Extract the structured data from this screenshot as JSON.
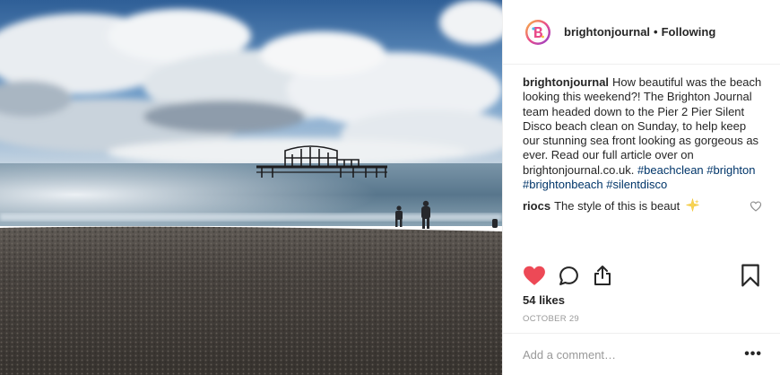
{
  "post": {
    "author": "brightonjournal",
    "follow_status": "Following",
    "separator": "•",
    "caption": "How beautiful was the beach looking this weekend?! The Brighton Journal team headed down to the Pier 2 Pier Silent Disco beach clean on Sunday, to help keep our stunning sea front looking as gorgeous as ever. Read our full article over on brightonjournal.co.uk.",
    "hashtags": [
      "#beachclean",
      "#brighton",
      "#brightonbeach",
      "#silentdisco"
    ],
    "comment": {
      "user": "riocs",
      "text": "The style of this is beaut"
    },
    "likes": "54 likes",
    "date": "OCTOBER 29",
    "add_comment_placeholder": "Add a comment…",
    "more_label": "•••"
  },
  "colors": {
    "like_red": "#ed4956",
    "hashtag_blue": "#003569",
    "muted_text": "#999999"
  },
  "icons": [
    "heart-icon",
    "comment-icon",
    "share-icon",
    "bookmark-icon",
    "small-heart-icon",
    "sparkle-emoji-icon",
    "more-options-icon"
  ]
}
